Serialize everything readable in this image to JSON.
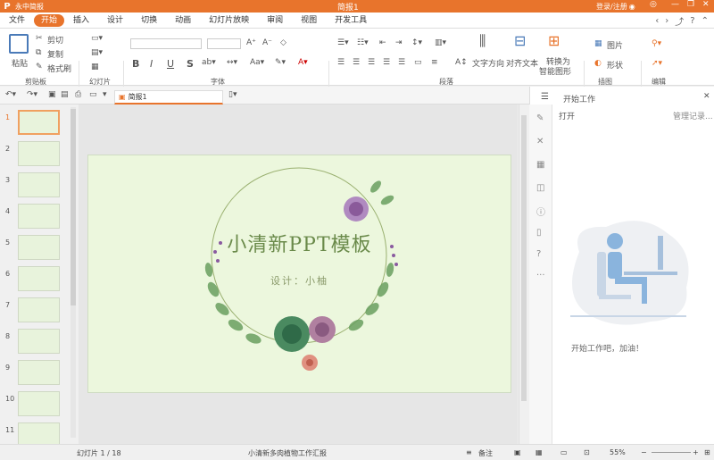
{
  "app": {
    "logo": "P",
    "name": "永中简报",
    "doc_title": "简报1",
    "login": "登录/注册"
  },
  "menu": {
    "tabs": [
      "文件",
      "开始",
      "插入",
      "设计",
      "切换",
      "动画",
      "幻灯片放映",
      "审阅",
      "视图",
      "开发工具"
    ],
    "active": 1
  },
  "ribbon": {
    "paste": "粘贴",
    "cut": "剪切",
    "copy": "复制",
    "format_painter": "格式刷",
    "clipboard": "剪贴板",
    "slide": "幻灯片",
    "font": "字体",
    "paragraph": "段落",
    "text_direction": "文字方向",
    "align_text": "对齐文本",
    "convert_smartart_1": "转换为",
    "convert_smartart_2": "智能图形",
    "picture": "图片",
    "shape": "形状",
    "illustration": "插图",
    "edit": "编辑"
  },
  "doc_tab": {
    "label": "简报1"
  },
  "thumbnails": [
    "1",
    "2",
    "3",
    "4",
    "5",
    "6",
    "7",
    "8",
    "9",
    "10",
    "11"
  ],
  "slide": {
    "title": "小清新PPT模板",
    "subtitle": "设计：小柚"
  },
  "right_panel": {
    "title": "开始工作",
    "open": "打开",
    "manage": "管理记录...",
    "message": "开始工作吧，加油！"
  },
  "status": {
    "slide_info": "幻灯片 1 / 18",
    "theme": "小清新多肉植物工作汇报",
    "notes": "备注",
    "zoom": "55%"
  },
  "colors": {
    "accent": "#e8742c",
    "slide_bg": "#ecf7dd"
  }
}
